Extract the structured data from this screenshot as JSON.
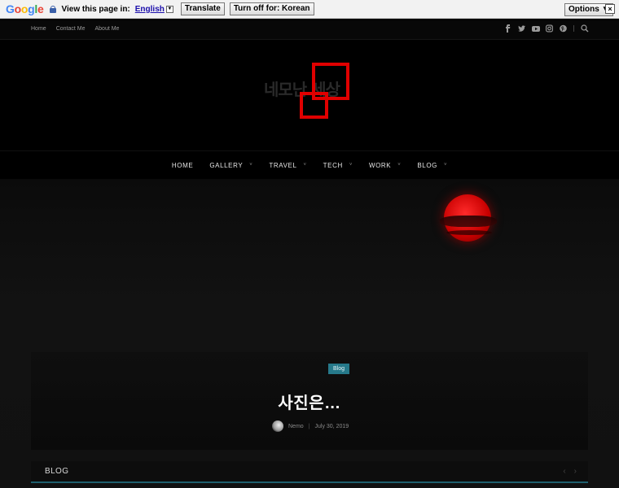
{
  "translate_bar": {
    "logo": "Google",
    "prompt": "View this page in:",
    "language": "English",
    "translate_label": "Translate",
    "turn_off_label": "Turn off for: Korean",
    "options_label": "Options ▼",
    "close_label": "×"
  },
  "topbar": {
    "links": [
      "Home",
      "Contact Me",
      "About Me"
    ],
    "social_icons": [
      "facebook-icon",
      "twitter-icon",
      "youtube-icon",
      "instagram-icon",
      "pinterest-icon",
      "search-icon"
    ]
  },
  "logo": {
    "text": "네모난 세상",
    "accent_color": "#e00000"
  },
  "nav": {
    "items": [
      {
        "label": "HOME",
        "has_dropdown": false
      },
      {
        "label": "GALLERY",
        "has_dropdown": true
      },
      {
        "label": "TRAVEL",
        "has_dropdown": true
      },
      {
        "label": "TECH",
        "has_dropdown": true
      },
      {
        "label": "WORK",
        "has_dropdown": true
      },
      {
        "label": "BLOG",
        "has_dropdown": true
      }
    ]
  },
  "hero": {
    "category": "Blog",
    "title": "사진은…",
    "author": "Nemo",
    "date": "July 30, 2019",
    "badge_color": "#26798a"
  },
  "section": {
    "title": "BLOG",
    "prev": "‹",
    "next": "›"
  }
}
